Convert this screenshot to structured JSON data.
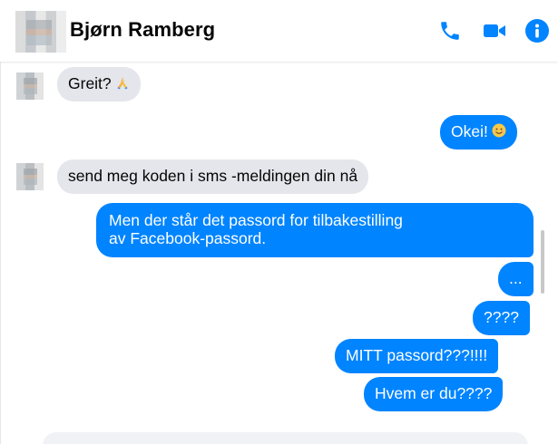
{
  "header": {
    "contact_name": "Bjørn Ramberg",
    "icons": {
      "phone": "phone-icon",
      "video": "video-camera-icon",
      "info": "info-icon"
    }
  },
  "colors": {
    "accent": "#0084ff",
    "incoming_bubble": "#e4e6eb",
    "text_dark": "#050505"
  },
  "messages": [
    {
      "direction": "in",
      "text": "Greit?",
      "emoji": "🙏"
    },
    {
      "direction": "out",
      "text": "Okei!",
      "emoji": "😊"
    },
    {
      "direction": "in",
      "text": "send meg koden i sms -meldingen din nå"
    },
    {
      "direction": "out",
      "line1": "Men der står det passord for tilbakestilling",
      "line2": "av Facebook-passord."
    },
    {
      "direction": "out",
      "text": "..."
    },
    {
      "direction": "out",
      "text": "????"
    },
    {
      "direction": "out",
      "text": "MITT passord???!!!!"
    },
    {
      "direction": "out",
      "text": "Hvem er du????"
    }
  ]
}
